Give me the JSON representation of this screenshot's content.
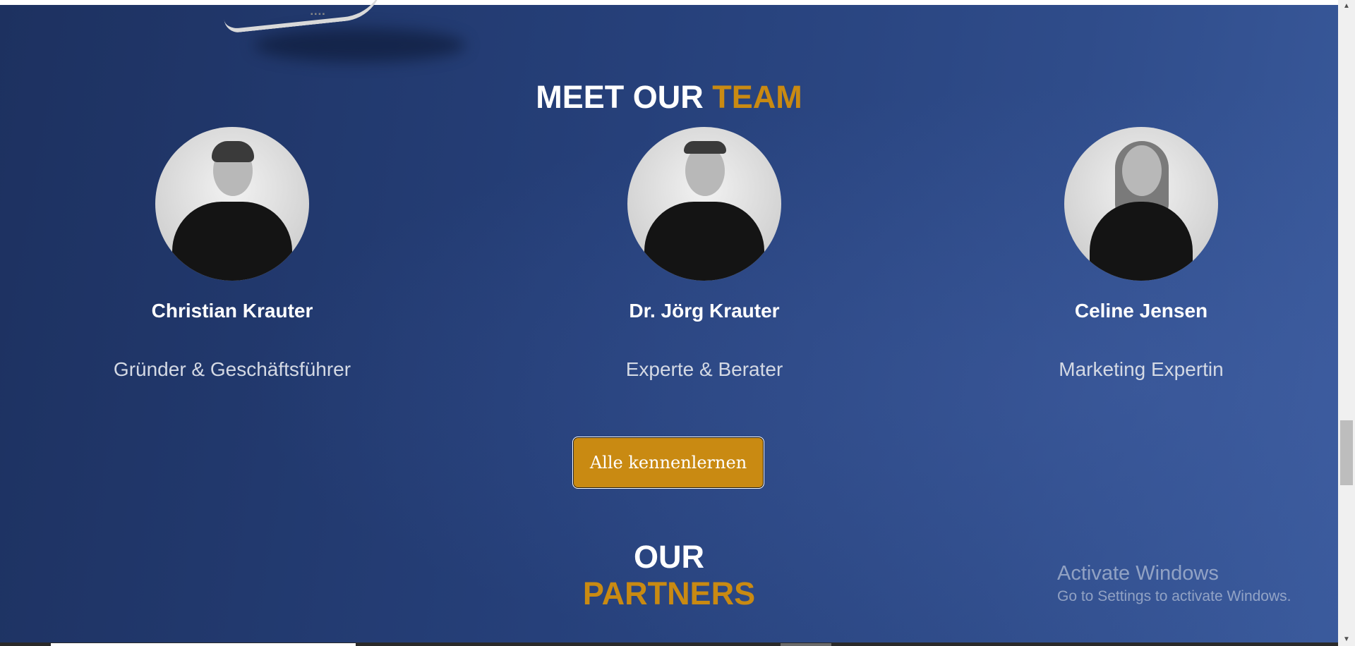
{
  "team_section": {
    "title_white": "MEET OUR",
    "title_accent": "TEAM"
  },
  "members": [
    {
      "name": "Christian Krauter",
      "role": "Gründer & Geschäftsführer"
    },
    {
      "name": "Dr. Jörg Krauter",
      "role": "Experte & Berater"
    },
    {
      "name": "Celine Jensen",
      "role": "Marketing Expertin"
    }
  ],
  "cta": {
    "label": "Alle kennenlernen"
  },
  "partners_section": {
    "title_white": "OUR",
    "title_accent": "PARTNERS"
  },
  "windows_watermark": {
    "title": "Activate Windows",
    "subtitle": "Go to Settings to activate Windows."
  },
  "colors": {
    "accent": "#c98a12",
    "background": "#26407a",
    "text": "#ffffff"
  },
  "icons": {
    "scroll_up": "triangle-up",
    "scroll_down": "triangle-down"
  }
}
